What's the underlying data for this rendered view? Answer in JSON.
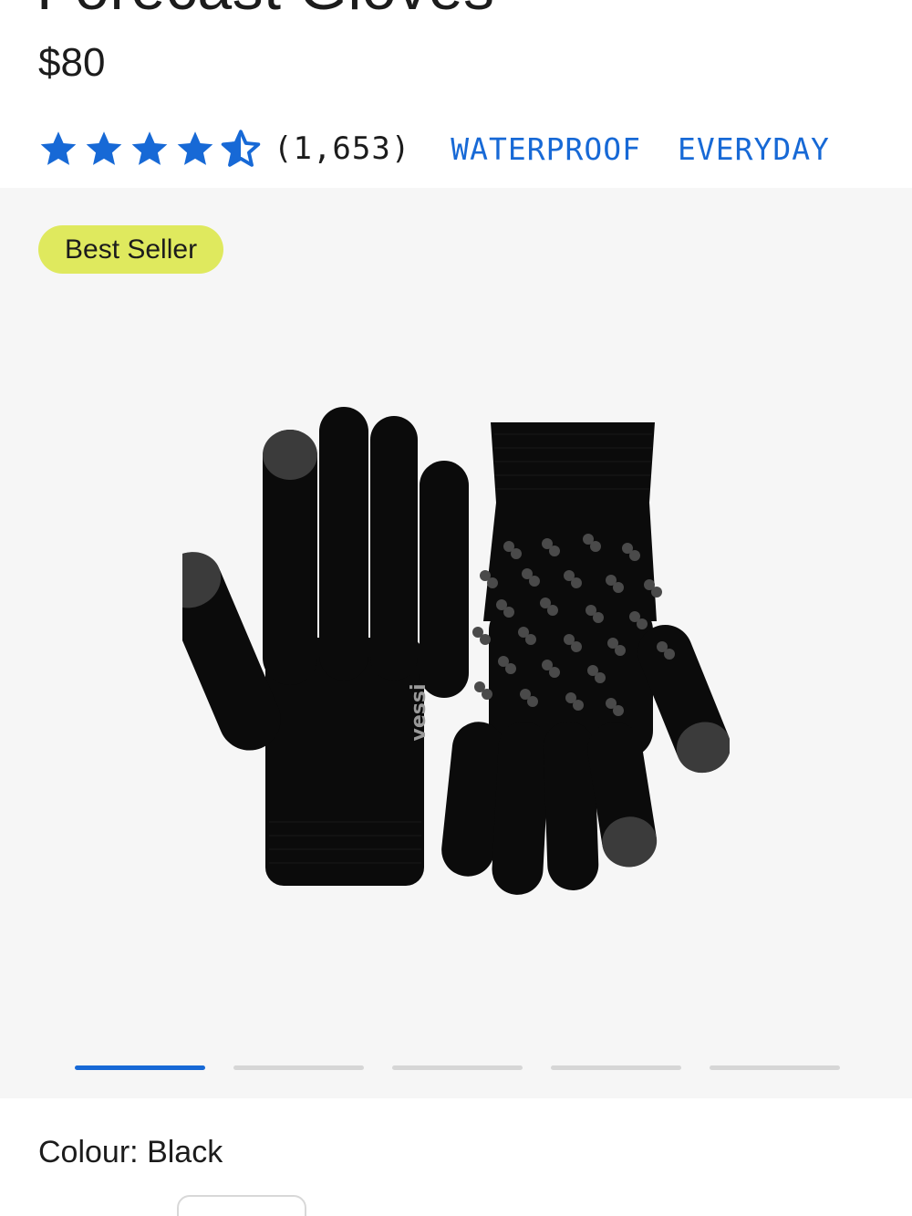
{
  "product": {
    "title": "Forecast Gloves",
    "price": "$80",
    "rating": {
      "value": 4.5,
      "max": 5,
      "review_count": "(1,653)"
    },
    "tags": [
      "WATERPROOF",
      "EVERYDAY"
    ],
    "badge": "Best Seller",
    "image_logo_text": "vessi",
    "colour_label": "Colour:",
    "colour_value": "Black"
  },
  "gallery": {
    "slide_count": 5,
    "active_index": 0
  },
  "colors": {
    "accent": "#1769d6",
    "badge_bg": "#dfe95e",
    "gallery_bg": "#f6f6f6",
    "text": "#1c1c1c"
  },
  "icons": {
    "star_full": "star-icon",
    "star_half": "half-star-icon"
  }
}
